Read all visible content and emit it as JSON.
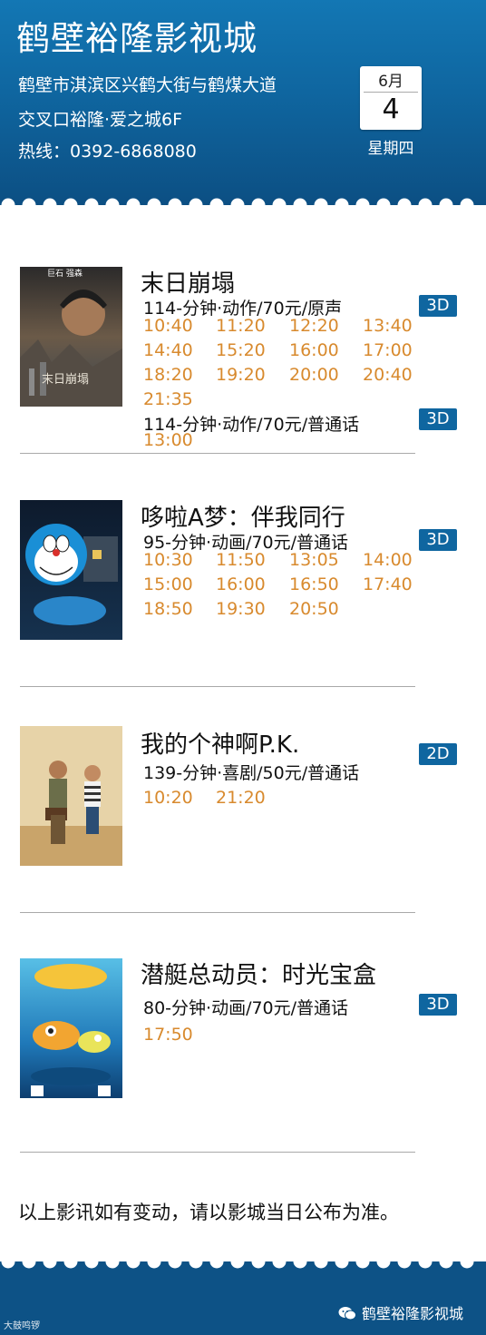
{
  "header": {
    "cinema_name": "鹤壁裕隆影视城",
    "address_line1": "鹤壁市淇滨区兴鹤大街与鹤煤大道",
    "address_line2": "交叉口裕隆·爱之城6F",
    "hotline": "热线：0392-6868080",
    "date": {
      "month": "6月",
      "day": "4",
      "weekday": "星期四"
    }
  },
  "movies": [
    {
      "title": "末日崩塌",
      "poster_texts": [
        "巨石 强森",
        "末日崩塌"
      ],
      "sessions": [
        {
          "info": "114-分钟·动作/70元/原声",
          "format": "3D",
          "times": [
            "10:40",
            "11:20",
            "12:20",
            "13:40",
            "14:40",
            "15:20",
            "16:00",
            "17:00",
            "18:20",
            "19:20",
            "20:00",
            "20:40",
            "21:35"
          ]
        },
        {
          "info": "114-分钟·动作/70元/普通话",
          "format": "3D",
          "times": [
            "13:00"
          ]
        }
      ]
    },
    {
      "title": "哆啦A梦：伴我同行",
      "sessions": [
        {
          "info": "95-分钟·动画/70元/普通话",
          "format": "3D",
          "times": [
            "10:30",
            "11:50",
            "13:05",
            "14:00",
            "15:00",
            "16:00",
            "16:50",
            "17:40",
            "18:50",
            "19:30",
            "20:50"
          ]
        }
      ]
    },
    {
      "title": "我的个神啊P.K.",
      "sessions": [
        {
          "info": "139-分钟·喜剧/50元/普通话",
          "format": "2D",
          "times": [
            "10:20",
            "21:20"
          ]
        }
      ]
    },
    {
      "title": "潜艇总动员：时光宝盒",
      "sessions": [
        {
          "info": "80-分钟·动画/70元/普通话",
          "format": "3D",
          "times": [
            "17:50"
          ]
        }
      ]
    }
  ],
  "notice": "以上影讯如有变动，请以影城当日公布为准。",
  "footer": {
    "wechat_account": "鹤壁裕隆影视城",
    "watermark": "大鼓鸣锣"
  },
  "colors": {
    "header_blue": "#0f66a0",
    "time_orange": "#d88a2e",
    "badge_blue": "#0f66a0"
  }
}
